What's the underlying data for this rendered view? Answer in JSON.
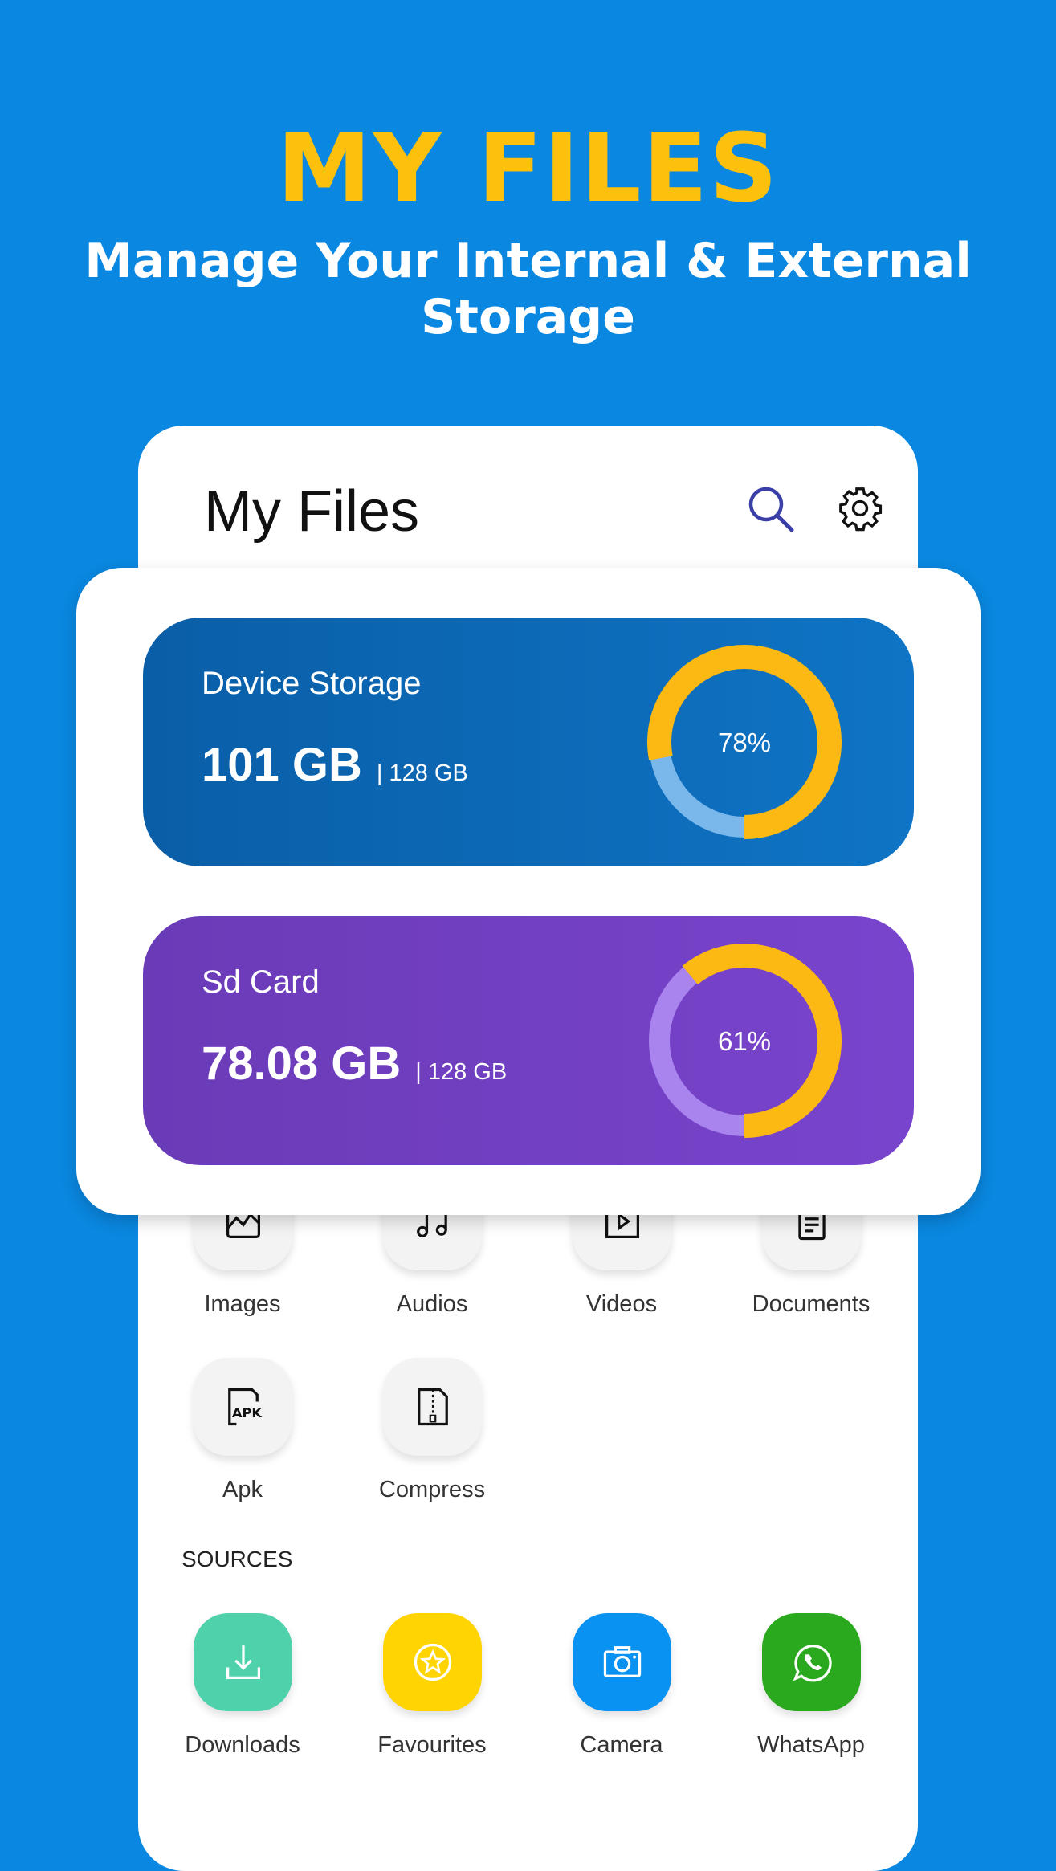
{
  "hero": {
    "title": "MY FILES",
    "subtitle": "Manage Your Internal & External Storage"
  },
  "app": {
    "title": "My Files",
    "icons": [
      "search-icon",
      "gear-icon"
    ]
  },
  "storage": [
    {
      "name": "Device Storage",
      "used": "101 GB",
      "total": "| 128 GB",
      "percent_label": "78%",
      "percent": 78,
      "used_color": "#FDB913",
      "track_color": "#7AB8EC"
    },
    {
      "name": "Sd Card",
      "used": "78.08 GB",
      "total": "| 128 GB",
      "percent_label": "61%",
      "percent": 61,
      "used_color": "#FDB913",
      "track_color": "#A983EE"
    }
  ],
  "categories": [
    {
      "label": "Images",
      "icon": "image-icon"
    },
    {
      "label": "Audios",
      "icon": "music-icon"
    },
    {
      "label": "Videos",
      "icon": "video-icon"
    },
    {
      "label": "Documents",
      "icon": "document-icon"
    },
    {
      "label": "Apk",
      "icon": "apk-icon"
    },
    {
      "label": "Compress",
      "icon": "zip-icon"
    }
  ],
  "sources_label": "SOURCES",
  "sources": [
    {
      "label": "Downloads",
      "icon": "download-icon",
      "color": "#4FD1AC"
    },
    {
      "label": "Favourites",
      "icon": "star-icon",
      "color": "#FFD400"
    },
    {
      "label": "Camera",
      "icon": "camera-icon",
      "color": "#0A92F2"
    },
    {
      "label": "WhatsApp",
      "icon": "whatsapp-icon",
      "color": "#2AA81E"
    }
  ]
}
